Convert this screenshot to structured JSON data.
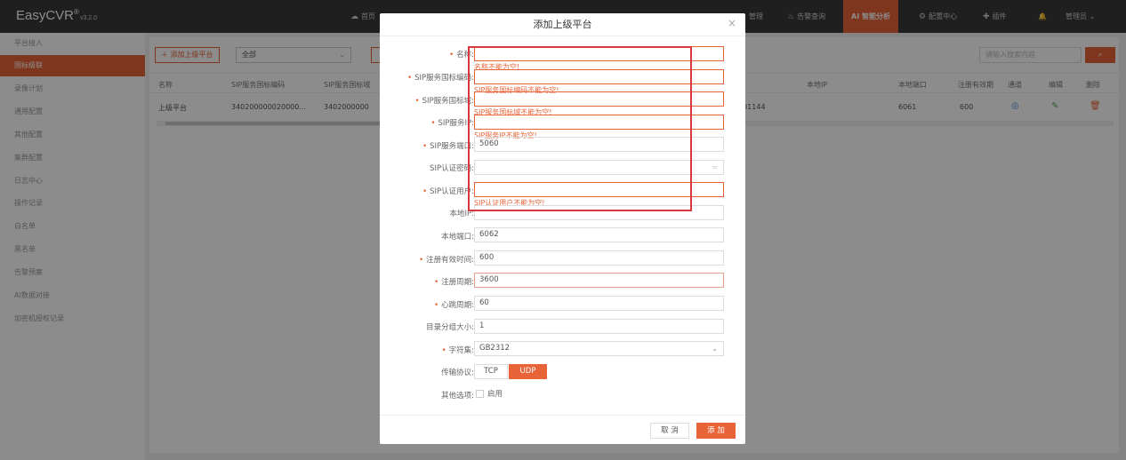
{
  "app": {
    "name": "EasyCVR",
    "version": "v3.2.0"
  },
  "nav": {
    "home": "首页",
    "device_mgmt": "管理",
    "alarm_query": "告警查询",
    "ai": "AI 智能分析",
    "config": "配置中心",
    "plugins": "插件",
    "admin": "管理员"
  },
  "sidebar": {
    "items": [
      {
        "label": "平台接入"
      },
      {
        "label": "国标级联"
      },
      {
        "label": "录像计划"
      },
      {
        "label": "通用配置"
      },
      {
        "label": "其他配置"
      },
      {
        "label": "集群配置"
      },
      {
        "label": "日志中心"
      },
      {
        "label": "操作记录"
      },
      {
        "label": "白名单"
      },
      {
        "label": "黑名单"
      },
      {
        "label": "告警预案"
      },
      {
        "label": "AI数据对接"
      },
      {
        "label": "加密机授权记录"
      }
    ]
  },
  "toolbar": {
    "add_label": "添加上级平台",
    "filter_value": "全部",
    "search_placeholder": "请输入搜索内容"
  },
  "table": {
    "headers": {
      "name": "名称",
      "sip_id": "SIP服务国标编码",
      "sip_domain": "SIP服务国标域",
      "local_ip": "本地IP",
      "local_port": "本地端口",
      "reg_expire": "注册有效期",
      "channel": "通道",
      "edit": "编辑",
      "delete": "删除"
    },
    "rows": [
      {
        "name": "上级平台",
        "sip_id": "340200000020000...",
        "sip_domain": "3402000000",
        "sip_tail": "001144",
        "local_port": "6061",
        "reg_expire": "600"
      }
    ]
  },
  "modal": {
    "title": "添加上级平台",
    "fields": [
      {
        "label": "名称",
        "required": true,
        "value": "",
        "error": "名称不能为空!"
      },
      {
        "label": "SIP服务国标编码",
        "required": true,
        "value": "",
        "error": "SIP服务国标编码不能为空!"
      },
      {
        "label": "SIP服务国标域",
        "required": true,
        "value": "",
        "error": "SIP服务国标域不能为空!"
      },
      {
        "label": "SIP服务IP",
        "required": true,
        "value": "",
        "error": "SIP服务IP不能为空!"
      },
      {
        "label": "SIP服务端口",
        "required": true,
        "value": "5060"
      },
      {
        "label": "SIP认证密码",
        "required": false,
        "value": ""
      },
      {
        "label": "SIP认证用户",
        "required": true,
        "value": "",
        "error": "SIP认证用户不能为空!"
      },
      {
        "label": "本地IP",
        "required": false,
        "value": ""
      },
      {
        "label": "本地端口",
        "required": false,
        "value": "6062"
      },
      {
        "label": "注册有效时间",
        "required": true,
        "value": "600"
      },
      {
        "label": "注册周期",
        "required": true,
        "value": "3600"
      },
      {
        "label": "心跳周期",
        "required": true,
        "value": "60"
      },
      {
        "label": "目录分组大小",
        "required": false,
        "value": "1"
      },
      {
        "label": "字符集",
        "required": true,
        "value": "GB2312"
      }
    ],
    "protocol_label": "传输协议",
    "protocols": [
      "TCP",
      "UDP"
    ],
    "selected_protocol": "UDP",
    "other_label": "其他选项",
    "enable_label": "启用",
    "cancel_label": "取 消",
    "add_label": "添 加"
  },
  "colors": {
    "accent": "#e86338",
    "topbar": "#3a3a3a",
    "highlight": "#d9363e"
  }
}
